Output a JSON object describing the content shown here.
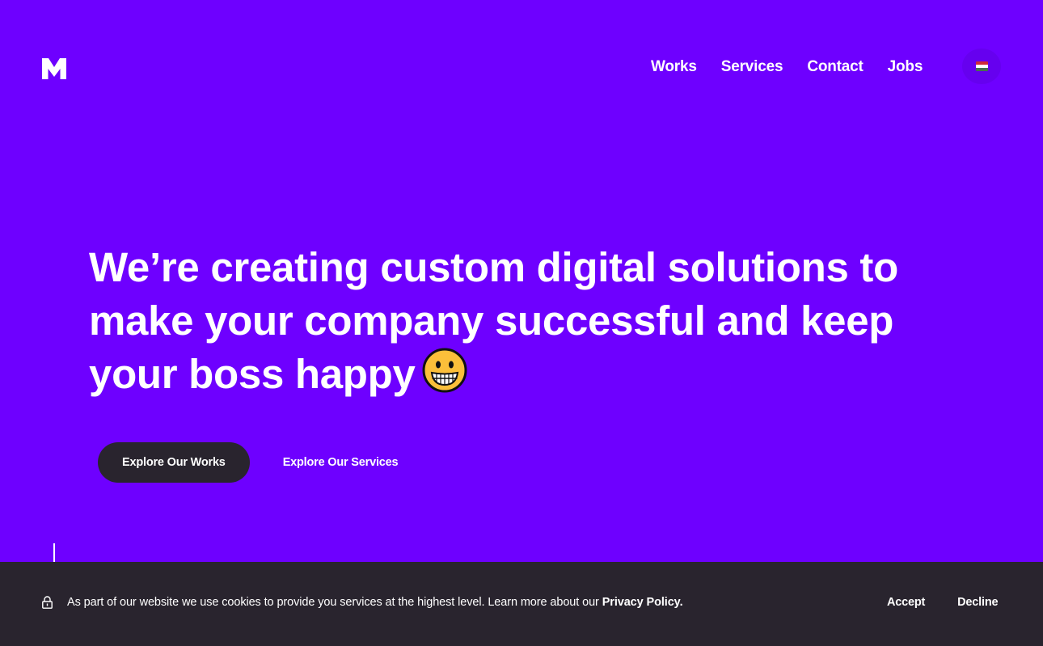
{
  "header": {
    "logo_text": "M",
    "nav": [
      {
        "label": "Works"
      },
      {
        "label": "Services"
      },
      {
        "label": "Contact"
      },
      {
        "label": "Jobs"
      }
    ],
    "language": {
      "icon": "hungarian-flag-icon",
      "flag_colors": [
        "#ce2939",
        "#ffffff",
        "#477050"
      ]
    }
  },
  "hero": {
    "headline": "We’re creating custom digital solutions to make your company successful and keep your boss happy",
    "emoji": "grinning-face-icon",
    "primary_cta": "Explore Our Works",
    "secondary_cta": "Explore Our Services"
  },
  "cookie_banner": {
    "icon": "lock-icon",
    "text": "As part of our website we use cookies to provide you services at the highest level. Learn more about our ",
    "policy_link": "Privacy Policy.",
    "accept_label": "Accept",
    "decline_label": "Decline"
  },
  "colors": {
    "brand_purple": "#6e00ff",
    "dark": "#29242e",
    "text": "#ffffff"
  }
}
